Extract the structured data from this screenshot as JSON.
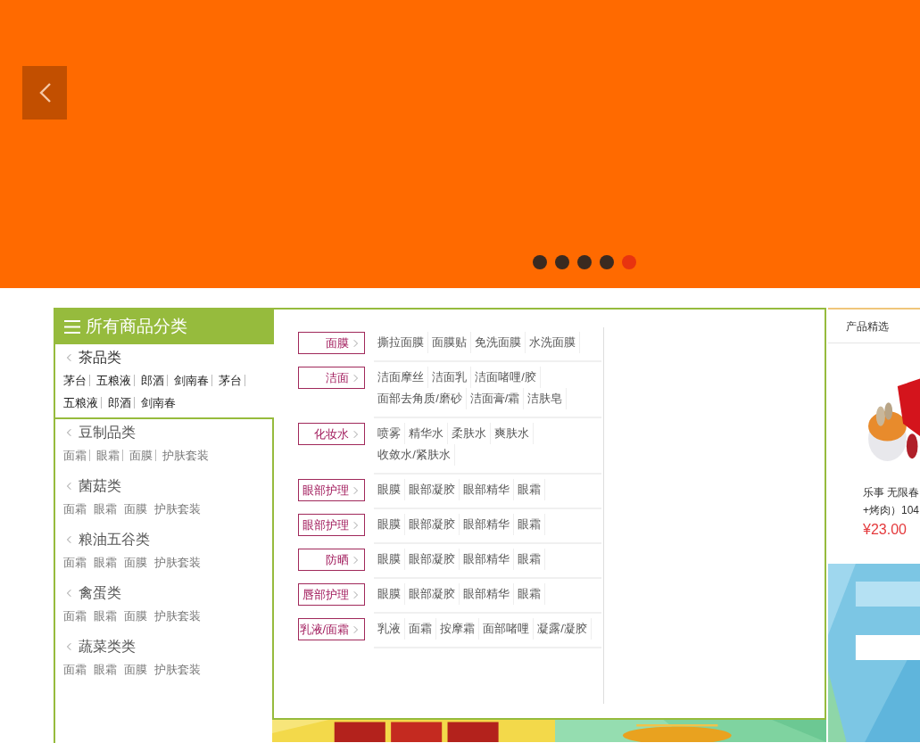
{
  "banner": {
    "slides": [
      {
        "selected": false
      },
      {
        "selected": false
      },
      {
        "selected": false
      },
      {
        "selected": false
      },
      {
        "selected": true
      }
    ]
  },
  "category_menu": {
    "title": "所有商品分类",
    "categories": [
      {
        "name": "茶品类",
        "selected": true,
        "links": [
          "茅台",
          "五粮液",
          "郎酒",
          "剑南春",
          "茅台",
          "五粮液",
          "郎酒",
          "剑南春"
        ],
        "separators": true
      },
      {
        "name": "豆制品类",
        "selected": false,
        "links": [
          "面霜",
          "眼霜",
          "面膜",
          "护肤套装"
        ],
        "separators": true
      },
      {
        "name": "菌菇类",
        "selected": false,
        "links": [
          "面霜",
          "眼霜",
          "面膜",
          "护肤套装"
        ],
        "separators": false
      },
      {
        "name": "粮油五谷类",
        "selected": false,
        "links": [
          "面霜",
          "眼霜",
          "面膜",
          "护肤套装"
        ],
        "separators": false
      },
      {
        "name": "禽蛋类",
        "selected": false,
        "links": [
          "面霜",
          "眼霜",
          "面膜",
          "护肤套装"
        ],
        "separators": false
      },
      {
        "name": "蔬菜类类",
        "selected": false,
        "links": [
          "面霜",
          "眼霜",
          "面膜",
          "护肤套装"
        ],
        "separators": false
      }
    ]
  },
  "subcategory_panel": {
    "groups": [
      {
        "name": "面膜",
        "links": [
          "撕拉面膜",
          "面膜贴",
          "免洗面膜",
          "水洗面膜"
        ]
      },
      {
        "name": "洁面",
        "links": [
          "洁面摩丝",
          "洁面乳",
          "洁面啫哩/胶",
          "面部去角质/磨砂",
          "洁面膏/霜",
          "洁肤皂"
        ]
      },
      {
        "name": "化妆水",
        "links": [
          "喷雾",
          "精华水",
          "柔肤水",
          "爽肤水",
          "收敛水/紧肤水"
        ]
      },
      {
        "name": "眼部护理",
        "links": [
          "眼膜",
          "眼部凝胶",
          "眼部精华",
          "眼霜"
        ]
      },
      {
        "name": "眼部护理",
        "links": [
          "眼膜",
          "眼部凝胶",
          "眼部精华",
          "眼霜"
        ]
      },
      {
        "name": "防晒",
        "links": [
          "眼膜",
          "眼部凝胶",
          "眼部精华",
          "眼霜"
        ]
      },
      {
        "name": "唇部护理",
        "links": [
          "眼膜",
          "眼部凝胶",
          "眼部精华",
          "眼霜"
        ]
      },
      {
        "name": "乳液/面霜",
        "links": [
          "乳液",
          "面霜",
          "按摩霜",
          "面部啫哩",
          "凝露/凝胶"
        ]
      }
    ]
  },
  "featured": {
    "tab": "产品精选",
    "product": {
      "name_lines": [
        "乐事 无限春",
        "+烤肉）104"
      ],
      "price": "¥23.00"
    }
  }
}
